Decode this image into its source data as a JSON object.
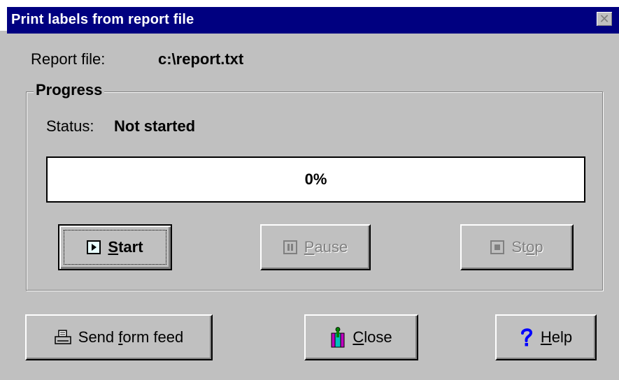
{
  "window": {
    "title": "Print labels from report file",
    "close_glyph": "✕"
  },
  "report": {
    "label": "Report file:",
    "path": "c:\\report.txt"
  },
  "progress_group": {
    "legend": "Progress",
    "status_label": "Status:",
    "status_value": "Not started",
    "percent": 0,
    "percent_text": "0%"
  },
  "controls": {
    "start": {
      "before": "",
      "mnemonic": "S",
      "after": "tart",
      "icon": "play-icon",
      "enabled": true
    },
    "pause": {
      "before": "",
      "mnemonic": "P",
      "after": "ause",
      "icon": "pause-icon",
      "enabled": false
    },
    "stop": {
      "before": "St",
      "mnemonic": "o",
      "after": "p",
      "icon": "stop-icon",
      "enabled": false
    }
  },
  "actions": {
    "form_feed": {
      "before": "Send ",
      "mnemonic": "f",
      "after": "orm feed",
      "icon": "printer-icon"
    },
    "close": {
      "before": "",
      "mnemonic": "C",
      "after": "lose",
      "icon": "door-exit-icon"
    },
    "help": {
      "before": "",
      "mnemonic": "H",
      "after": "elp",
      "icon": "question-mark-icon"
    }
  },
  "colors": {
    "face": "#c0c0c0",
    "titlebar": "#000080",
    "help_icon": "#0000ff",
    "disabled_text": "#808080"
  }
}
